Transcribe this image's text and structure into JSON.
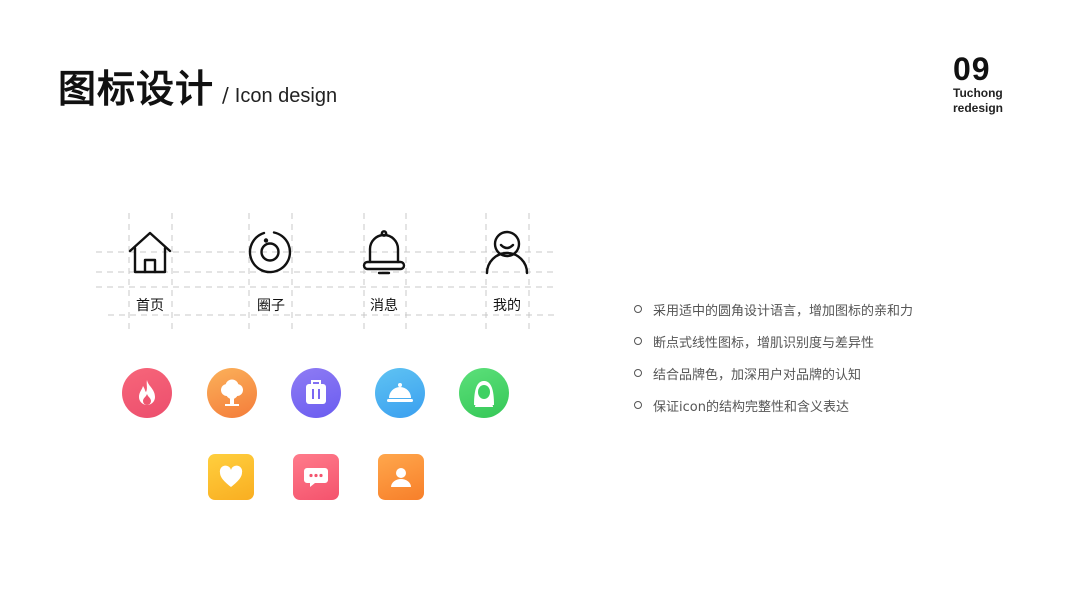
{
  "header": {
    "title_zh": "图标设计",
    "separator": "/",
    "title_en": "Icon design"
  },
  "page": {
    "number": "09",
    "caption_line1": "Tuchong",
    "caption_line2": "redesign"
  },
  "tabs": [
    {
      "label": "首页",
      "icon": "home-icon"
    },
    {
      "label": "圈子",
      "icon": "circle-icon"
    },
    {
      "label": "消息",
      "icon": "bell-icon"
    },
    {
      "label": "我的",
      "icon": "user-icon"
    }
  ],
  "round_icons": [
    {
      "icon": "flame-icon",
      "gradient": [
        "#f7667a",
        "#ec4e6d"
      ]
    },
    {
      "icon": "tree-icon",
      "gradient": [
        "#fbb15a",
        "#f47c3a"
      ]
    },
    {
      "icon": "suitcase-icon",
      "gradient": [
        "#8f7cf4",
        "#6a5cf0"
      ]
    },
    {
      "icon": "food-cloche-icon",
      "gradient": [
        "#5fc3f2",
        "#3a9ff0"
      ]
    },
    {
      "icon": "girl-avatar-icon",
      "gradient": [
        "#5ce07a",
        "#35c757"
      ]
    }
  ],
  "square_icons": [
    {
      "icon": "heart-icon",
      "gradient": [
        "#ffcf3e",
        "#f9ae21"
      ]
    },
    {
      "icon": "chat-bubble-icon",
      "gradient": [
        "#ff7b8b",
        "#f4536d"
      ]
    },
    {
      "icon": "person-card-icon",
      "gradient": [
        "#ffa74c",
        "#f77f2a"
      ]
    }
  ],
  "points": [
    "采用适中的圆角设计语言，增加图标的亲和力",
    "断点式线性图标，增肌识别度与差异性",
    "结合品牌色，加深用户对品牌的认知",
    "保证icon的结构完整性和含义表达"
  ],
  "colors": {
    "text_primary": "#111111",
    "text_secondary": "#555555",
    "guide_line": "#c8c8c8"
  }
}
